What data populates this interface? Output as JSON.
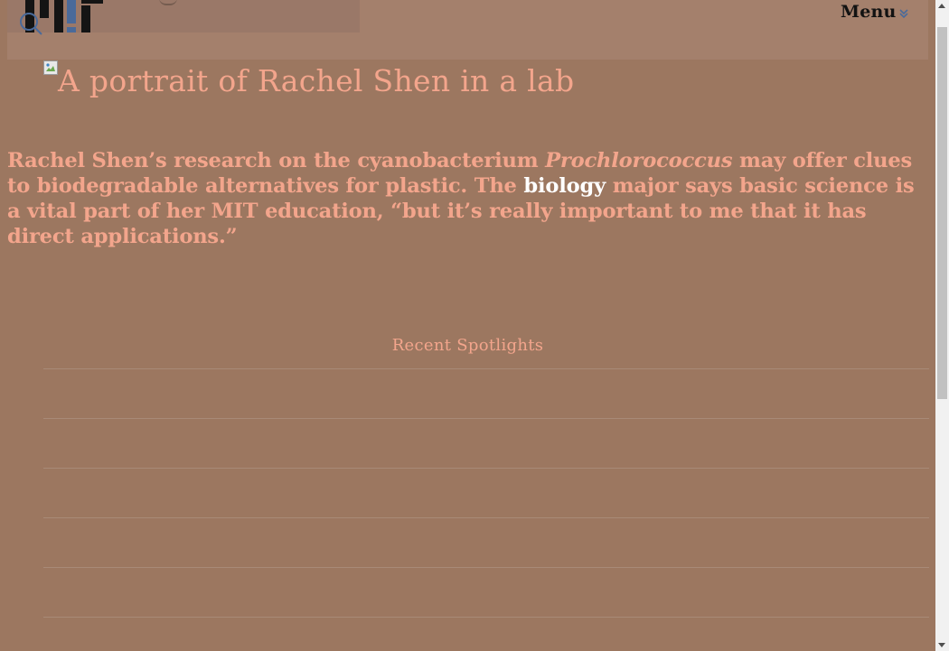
{
  "header": {
    "menu_label": "Menu",
    "logo_name": "MIT"
  },
  "hero": {
    "image_alt": "A portrait of Rachel Shen in a lab"
  },
  "intro": {
    "before_italic": "Rachel Shen’s research on the cyanobacterium ",
    "italic": "Prochlorococcus",
    "after_italic": " may offer clues to biodegradable alternatives for plastic. The ",
    "link": "biology",
    "after_link": " major says basic science is a vital part of her MIT education, “but it’s really important to me that it has direct applications.”"
  },
  "spotlights": {
    "heading": "Recent Spotlights",
    "items": [
      "",
      "",
      "",
      "",
      "",
      ""
    ]
  },
  "colors": {
    "page_bg": "#9c7760",
    "header_bg": "#a4806c",
    "accent_text": "#f3a58c",
    "link_text": "#ffffff",
    "icon_blue": "#4a6a9a"
  },
  "icons": {
    "search": "search-icon",
    "menu_chevron": "chevron-down-icon",
    "broken_image": "broken-image-icon"
  }
}
